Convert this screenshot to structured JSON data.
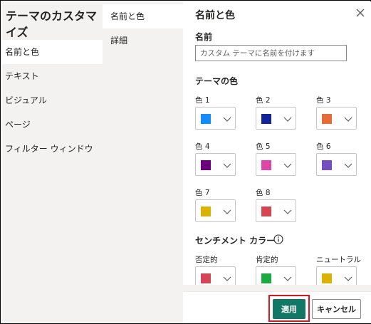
{
  "left_nav": {
    "title": "テーマのカスタマイズ",
    "items": [
      {
        "label": "名前と色"
      },
      {
        "label": "テキスト"
      },
      {
        "label": "ビジュアル"
      },
      {
        "label": "ページ"
      },
      {
        "label": "フィルター ウィンドウ"
      }
    ]
  },
  "sub_nav": {
    "items": [
      {
        "label": "名前と色"
      },
      {
        "label": "詳細"
      }
    ]
  },
  "panel": {
    "title": "名前と色",
    "name_label": "名前",
    "name_placeholder": "カスタム テーマに名前を付けます",
    "theme_colors_title": "テーマの色",
    "theme_colors": [
      {
        "label": "色 1",
        "color": "#118dff"
      },
      {
        "label": "色 2",
        "color": "#12239e"
      },
      {
        "label": "色 3",
        "color": "#e66c37"
      },
      {
        "label": "色 4",
        "color": "#6b007b"
      },
      {
        "label": "色 5",
        "color": "#e044a7"
      },
      {
        "label": "色 6",
        "color": "#744ec2"
      },
      {
        "label": "色 7",
        "color": "#d9b300"
      },
      {
        "label": "色 8",
        "color": "#d64550"
      }
    ],
    "sentiment_title": "センチメント カラー",
    "sentiment_colors": [
      {
        "label": "否定的",
        "color": "#d64554"
      },
      {
        "label": "肯定的",
        "color": "#15c6a0"
      },
      {
        "label": "ニュートラル",
        "color": "#d9b300"
      }
    ]
  },
  "footer": {
    "apply_label": "適用",
    "cancel_label": "キャンセル"
  },
  "colors": {
    "accent": "#117865",
    "highlight": "#e0141e",
    "nav_bg": "#f3f2f1",
    "positive_swatch": "#1aab40"
  }
}
